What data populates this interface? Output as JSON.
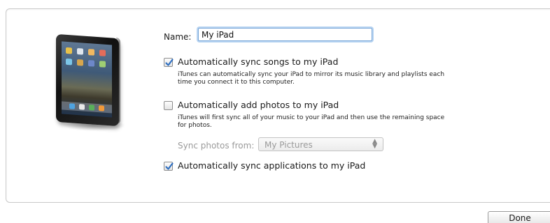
{
  "form": {
    "name_label": "Name:",
    "name_value": "My iPad"
  },
  "options": [
    {
      "label": "Automatically sync songs to my iPad",
      "checked": true,
      "description": [
        "iTunes can automatically sync your iPad to mirror its music library and playlists each",
        "time you connect it to this computer."
      ]
    },
    {
      "label": "Automatically add photos to my iPad",
      "checked": false,
      "description": [
        "iTunes will first sync all of your music to your iPad and then use the remaining space",
        "for photos."
      ]
    },
    {
      "label": "Automatically sync applications to my iPad",
      "checked": true,
      "description": []
    }
  ],
  "sync_photos": {
    "label": "Sync photos from:",
    "selected": "My Pictures"
  },
  "footer": {
    "done_label": "Done"
  },
  "colors": {
    "checkmark": "#2f6fc0",
    "focus_ring": "#7aa7d8",
    "disabled_text": "#9a9a9a"
  },
  "icons": {
    "device": "ipad-icon",
    "checkmark": "checkmark-icon",
    "select_arrows": "up-down-arrows-icon"
  }
}
